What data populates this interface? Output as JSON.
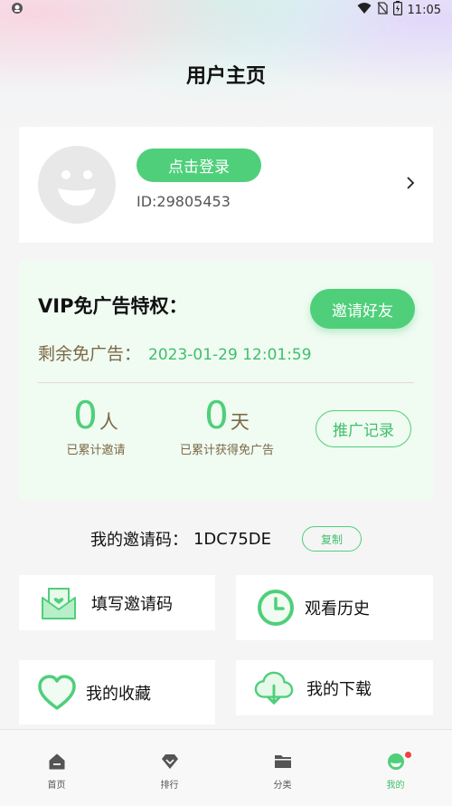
{
  "status_bar": {
    "time": "11:05"
  },
  "header": {
    "title": "用户主页"
  },
  "profile": {
    "login_label": "点击登录",
    "user_id": "ID:29805453"
  },
  "vip": {
    "title": "VIP免广告特权：",
    "invite_friends_label": "邀请好友",
    "remain_label": "剩余免广告：",
    "remain_until": "2023-01-29 12:01:59",
    "invited_count": "0",
    "invited_unit": "人",
    "invited_label": "已累计邀请",
    "ad_free_days": "0",
    "ad_free_unit": "天",
    "ad_free_label": "已累计获得免广告",
    "promo_record_label": "推广记录"
  },
  "invite_code": {
    "label": "我的邀请码：",
    "value": "1DC75DE",
    "copy_label": "复制"
  },
  "menu": {
    "fill_invite_code": "填写邀请码",
    "watch_history": "观看历史",
    "my_favorites": "我的收藏",
    "my_downloads": "我的下载"
  },
  "tabs": [
    {
      "label": "首页"
    },
    {
      "label": "排行"
    },
    {
      "label": "分类"
    },
    {
      "label": "我的"
    }
  ],
  "colors": {
    "accent": "#4fcf7a",
    "accent_text": "#3fbf6a",
    "muted_brown": "#7b6a45",
    "badge_red": "#f04040"
  }
}
